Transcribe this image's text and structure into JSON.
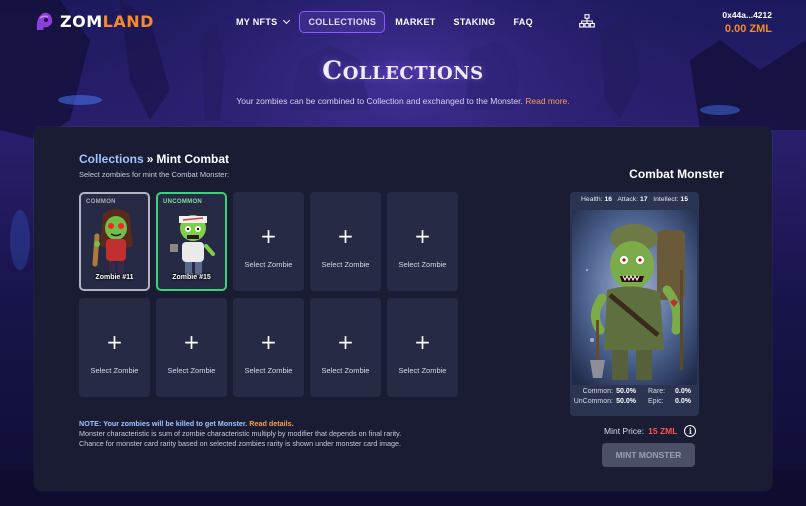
{
  "brand": {
    "part1": "ZOM",
    "part2": "LAND"
  },
  "nav": {
    "my_nfts": "MY NFTS",
    "collections": "COLLECTIONS",
    "market": "MARKET",
    "staking": "STAKING",
    "faq": "FAQ"
  },
  "wallet": {
    "address": "0x44a...4212",
    "balance": "0.00 ZML"
  },
  "hero": {
    "title": "Collections",
    "subtitle": "Your zombies can be combined to Collection and exchanged to the Monster.",
    "read_more": "Read more."
  },
  "breadcrumb": {
    "parent": "Collections",
    "separator": "»",
    "current": "Mint Combat"
  },
  "select_hint": "Select zombies for mint the Combat Monster:",
  "selected_zombies": [
    {
      "rarity": "COMMON",
      "name": "Zombie #11"
    },
    {
      "rarity": "UNCOMMON",
      "name": "Zombie #15"
    }
  ],
  "empty_slot_label": "Select Zombie",
  "empty_slot_plus": "+",
  "note": {
    "warning": "NOTE: Your zombies will be killed to get Monster.",
    "details_link": "Read details.",
    "line2": "Monster characteristic is sum of zombie characteristic multiply by modifier that depends on final rarity.",
    "line3": "Chance for monster card rarity based on selected zombies rarity is shown under monster card image."
  },
  "monster": {
    "title": "Combat Monster",
    "health_label": "Health:",
    "health": "16",
    "attack_label": "Attack:",
    "attack": "17",
    "intellect_label": "Intellect:",
    "intellect": "15",
    "common_label": "Common:",
    "common": "50.0%",
    "uncommon_label": "UnCommon:",
    "uncommon": "50.0%",
    "rare_label": "Rare:",
    "rare": "0.0%",
    "epic_label": "Epic:",
    "epic": "0.0%",
    "price_label": "Mint Price:",
    "price": "15 ZML",
    "mint_button": "MINT MONSTER"
  },
  "colors": {
    "accent_orange": "#f58a2a",
    "accent_purple": "#8a5cff",
    "common_border": "#b3b3c3",
    "uncommon_border": "#3ed07a",
    "price_red": "#ff5252"
  }
}
